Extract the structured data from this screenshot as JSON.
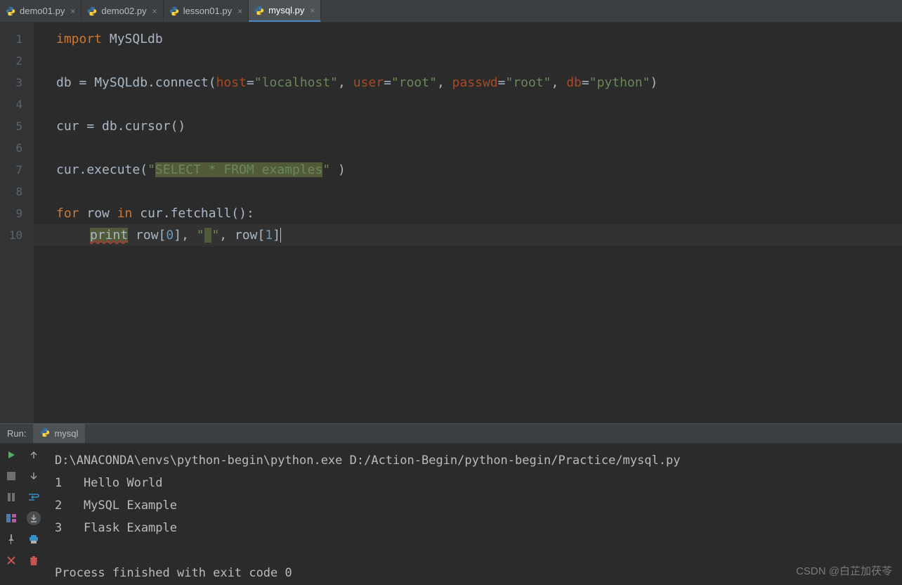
{
  "tabs": [
    {
      "label": "demo01.py",
      "active": false
    },
    {
      "label": "demo02.py",
      "active": false
    },
    {
      "label": "lesson01.py",
      "active": false
    },
    {
      "label": "mysql.py",
      "active": true
    }
  ],
  "lineNumbers": [
    "1",
    "2",
    "3",
    "4",
    "5",
    "6",
    "7",
    "8",
    "9",
    "10"
  ],
  "code": {
    "l1": {
      "kw_import": "import",
      "ident": " MySQLdb"
    },
    "l3": {
      "a": "db ",
      "op": "=",
      "b": " MySQLdb.connect(",
      "p_host": "host",
      "eq1": "=",
      "s_host": "\"localhost\"",
      "c1": ", ",
      "p_user": "user",
      "eq2": "=",
      "s_user": "\"root\"",
      "c2": ", ",
      "p_pass": "passwd",
      "eq3": "=",
      "s_pass": "\"root\"",
      "c3": ", ",
      "p_db": "db",
      "eq4": "=",
      "s_db": "\"python\"",
      "close": ")"
    },
    "l5": {
      "a": "cur ",
      "op": "=",
      "b": " db.cursor()"
    },
    "l7": {
      "a": "cur.execute(",
      "s_open": "\"",
      "hl": "SELECT * FROM examples",
      "s_close": "\"",
      "tail": " )"
    },
    "l9": {
      "kw_for": "for",
      "a": " row ",
      "kw_in": "in",
      "b": " cur.fetchall():"
    },
    "l10": {
      "print": "print",
      "sp": " ",
      "row": "row",
      "lb1": "[",
      "n0": "0",
      "rb1": "]",
      "c": ", ",
      "s_q1": "\"",
      "s_sp": " ",
      "s_q2": "\"",
      "c2": ", ",
      "row2": "row",
      "lb2": "[",
      "n1": "1",
      "rb2": "]"
    }
  },
  "run": {
    "label": "Run:",
    "tab": "mysql",
    "lines": [
      "D:\\ANACONDA\\envs\\python-begin\\python.exe D:/Action-Begin/python-begin/Practice/mysql.py",
      "1   Hello World",
      "2   MySQL Example",
      "3   Flask Example",
      "",
      "Process finished with exit code 0"
    ]
  },
  "watermark": "CSDN @白芷加茯苓"
}
